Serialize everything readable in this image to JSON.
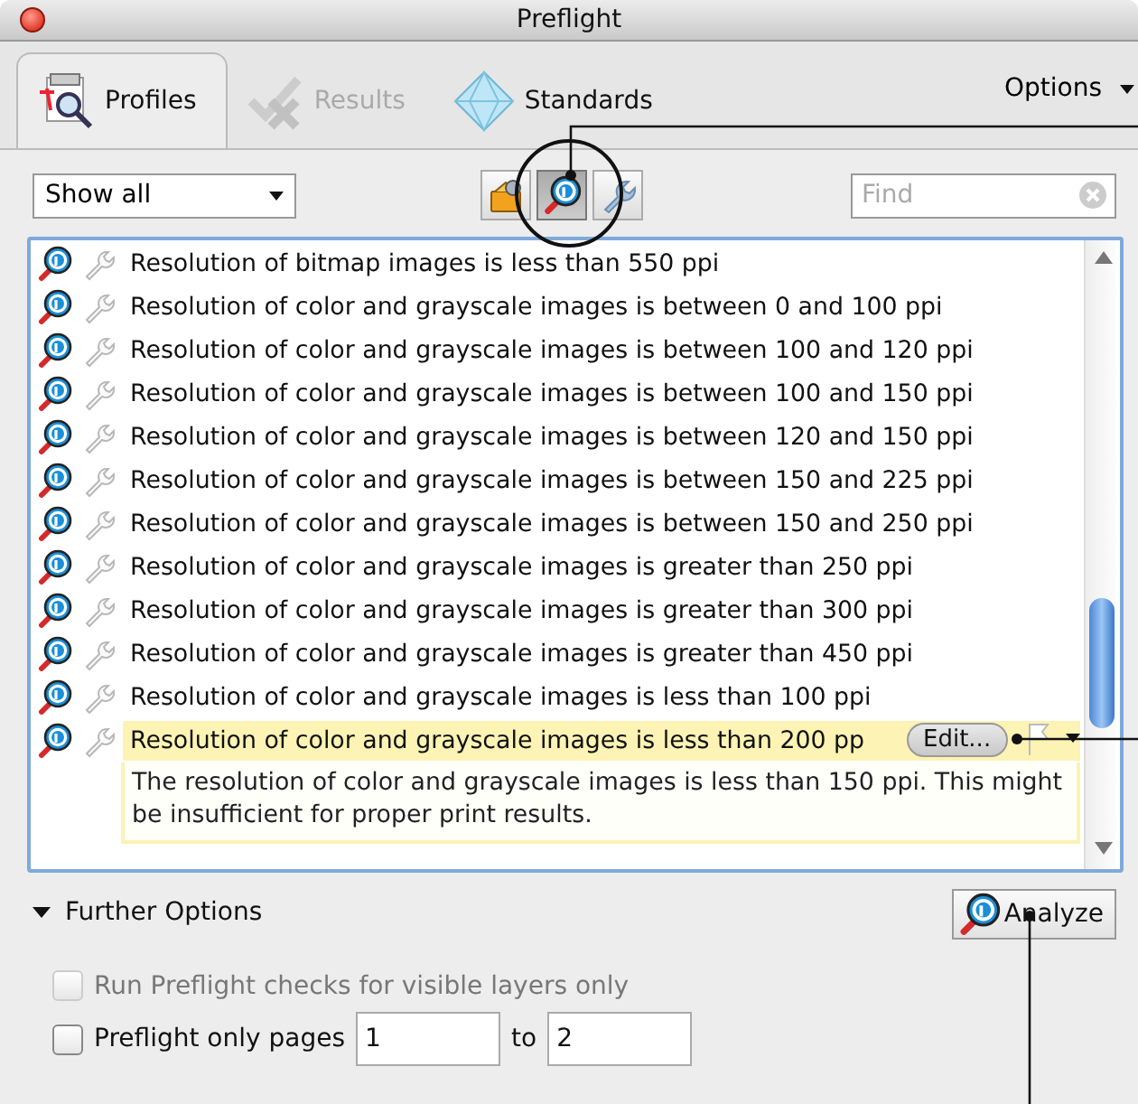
{
  "window": {
    "title": "Preflight"
  },
  "tabs": [
    {
      "label": "Profiles",
      "kind": "profiles",
      "selected": true,
      "disabled": false
    },
    {
      "label": "Results",
      "kind": "results",
      "selected": false,
      "disabled": true
    },
    {
      "label": "Standards",
      "kind": "standards",
      "selected": false,
      "disabled": false
    }
  ],
  "options_menu": {
    "label": "Options"
  },
  "toolbar": {
    "filter": {
      "value": "Show all"
    },
    "view_buttons": [
      {
        "kind": "fixups",
        "selected": false
      },
      {
        "kind": "profiles",
        "selected": true
      },
      {
        "kind": "checks",
        "selected": false
      }
    ],
    "search": {
      "placeholder": "Find"
    }
  },
  "profiles": [
    {
      "label": "Resolution of bitmap images is less than 550 ppi",
      "selected": false
    },
    {
      "label": "Resolution of color and grayscale images is between 0 and 100 ppi",
      "selected": false
    },
    {
      "label": "Resolution of color and grayscale images is between 100 and 120 ppi",
      "selected": false
    },
    {
      "label": "Resolution of color and grayscale images is between 100 and 150 ppi",
      "selected": false
    },
    {
      "label": "Resolution of color and grayscale images is between 120 and 150 ppi",
      "selected": false
    },
    {
      "label": "Resolution of color and grayscale images is between 150 and 225 ppi",
      "selected": false
    },
    {
      "label": "Resolution of color and grayscale images is between 150 and 250 ppi",
      "selected": false
    },
    {
      "label": "Resolution of color and grayscale images is greater than 250 ppi",
      "selected": false
    },
    {
      "label": "Resolution of color and grayscale images is greater than 300 ppi",
      "selected": false
    },
    {
      "label": "Resolution of color and grayscale images is greater than 450 ppi",
      "selected": false
    },
    {
      "label": "Resolution of color and grayscale images is less than 100 ppi",
      "selected": false
    },
    {
      "label": "Resolution of color and grayscale images is less than 200 pp",
      "selected": true,
      "edit_button": "Edit...",
      "description": "The resolution of color and grayscale images is less than 150 ppi. This might be insufficient for proper print results."
    }
  ],
  "further_options": {
    "label": "Further Options",
    "expanded": true
  },
  "analyze_button": {
    "label": "Analyze"
  },
  "options": [
    {
      "label": "Run Preflight checks for visible layers only",
      "checked": false,
      "disabled": true
    },
    {
      "label": "Preflight only pages",
      "checked": false,
      "disabled": false,
      "from": "1",
      "to_label": "to",
      "to": "2"
    }
  ]
}
